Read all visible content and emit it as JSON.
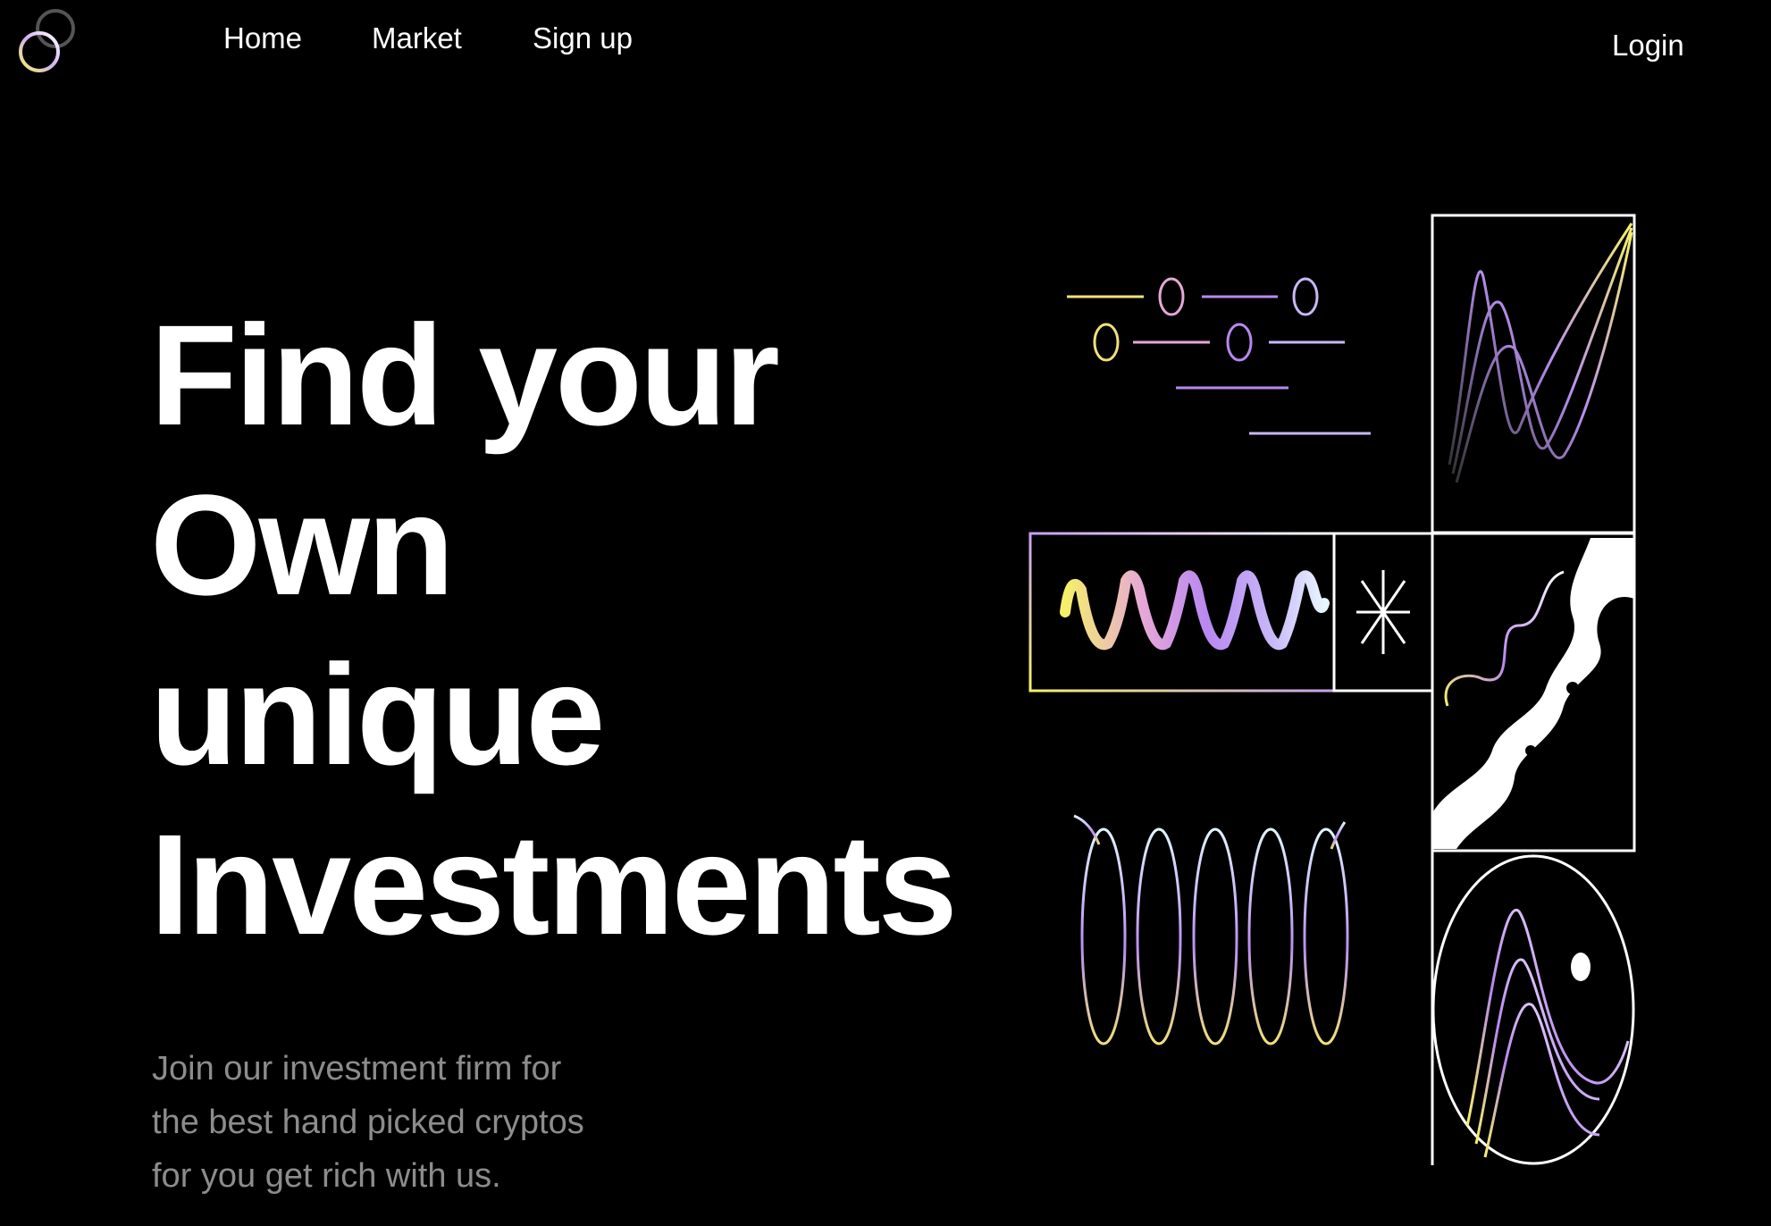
{
  "nav": {
    "logo_icon": "interlocking-rings-logo",
    "links": [
      {
        "label": "Home"
      },
      {
        "label": "Market"
      },
      {
        "label": "Sign up"
      }
    ],
    "login_label": "Login"
  },
  "hero": {
    "headline_lines": [
      "Find your",
      "Own",
      "unique",
      "Investments"
    ],
    "subtitle_lines": [
      "Join our investment firm for",
      "the best hand picked cryptos",
      "for you get rich with us."
    ]
  },
  "colors": {
    "background": "#000000",
    "text": "#ffffff",
    "muted_text": "#8c8c8c",
    "accent_yellow": "#f5f06a",
    "accent_pink": "#e6a8d8",
    "accent_purple": "#b888f0",
    "accent_lavender": "#c8b8f8",
    "accent_ice": "#d8f0ff"
  },
  "illustration": {
    "icons": [
      "slider-lines-icon",
      "line-chart-icon",
      "wave-icon",
      "asterisk-icon",
      "blob-pattern-icon",
      "coil-icon",
      "face-curve-icon"
    ]
  }
}
